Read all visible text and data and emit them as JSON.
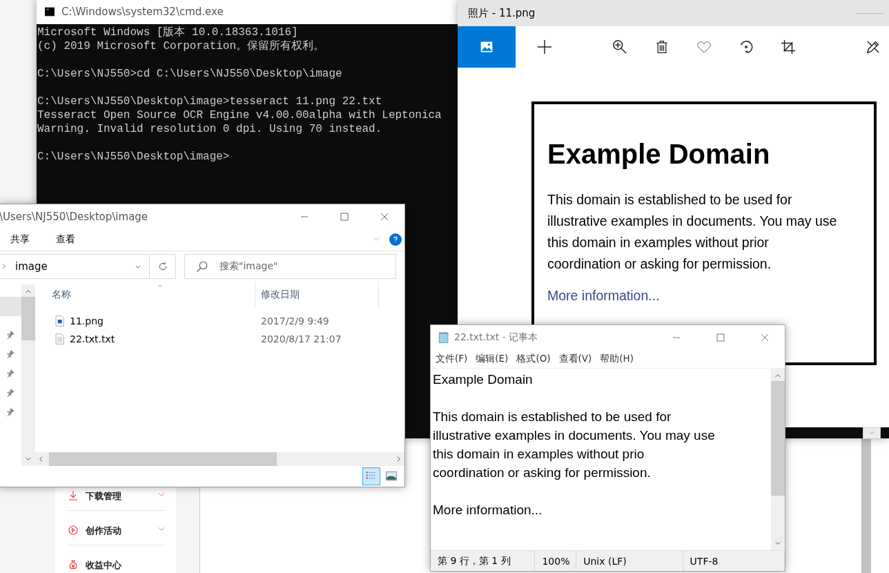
{
  "background_page": {
    "sidebar_items": [
      {
        "label": "下载管理",
        "kind": "download"
      },
      {
        "label": "创作活动",
        "kind": "activity"
      },
      {
        "label": "收益中心",
        "kind": "income"
      }
    ]
  },
  "cmd_window": {
    "title": "C:\\Windows\\system32\\cmd.exe",
    "blocks": [
      [
        "Microsoft Windows [版本 10.0.18363.1016]",
        "(c) 2019 Microsoft Corporation。保留所有权利。"
      ],
      [
        "C:\\Users\\NJ550>cd C:\\Users\\NJ550\\Desktop\\image"
      ],
      [
        "C:\\Users\\NJ550\\Desktop\\image>tesseract 11.png 22.txt",
        "Tesseract Open Source OCR Engine v4.00.00alpha with Leptonica",
        "Warning. Invalid resolution 0 dpi. Using 70 instead."
      ],
      [
        "C:\\Users\\NJ550\\Desktop\\image>"
      ]
    ]
  },
  "photos_window": {
    "title": "照片 - 11.png",
    "toolbar": [
      {
        "kind": "image",
        "selected": true,
        "disabled": false
      },
      {
        "kind": "add",
        "selected": false,
        "disabled": false
      },
      {
        "kind": "zoom-in",
        "selected": false,
        "disabled": false
      },
      {
        "kind": "delete",
        "selected": false,
        "disabled": false
      },
      {
        "kind": "favorite",
        "selected": false,
        "disabled": true
      },
      {
        "kind": "rotate",
        "selected": false,
        "disabled": false
      },
      {
        "kind": "crop",
        "selected": false,
        "disabled": false
      },
      {
        "kind": "edit",
        "selected": false,
        "disabled": false
      }
    ],
    "document": {
      "heading": "Example Domain",
      "paragraph_lines": [
        "This domain is established to be used for",
        "illustrative examples in documents. You may use",
        "this domain in examples without prior",
        "coordination or asking for permission."
      ],
      "link": "More information..."
    }
  },
  "explorer_window": {
    "title": "\\Users\\NJ550\\Desktop\\image",
    "ribbon_tabs": [
      "共享",
      "查看"
    ],
    "address": "image",
    "search": {
      "placeholder": "搜索\"image\""
    },
    "columns": [
      "名称",
      "修改日期"
    ],
    "rows": [
      {
        "name": "11.png",
        "modified": "2017/2/9 9:49",
        "kind": "image"
      },
      {
        "name": "22.txt.txt",
        "modified": "2020/8/17 21:07",
        "kind": "text"
      }
    ],
    "view_buttons": [
      {
        "kind": "details",
        "selected": true
      },
      {
        "kind": "thumbnails",
        "selected": false
      }
    ]
  },
  "notepad_window": {
    "title": "22.txt.txt - 记事本",
    "menus": [
      "文件(F)",
      "编辑(E)",
      "格式(O)",
      "查看(V)",
      "帮助(H)"
    ],
    "blocks": [
      [
        "Example Domain"
      ],
      [
        "This domain is established to be used for",
        "illustrative examples in documents. You may use",
        "this domain in examples without prio",
        "coordination or asking for permission."
      ],
      [
        "More information..."
      ]
    ],
    "status": [
      "第 9 行，第 1 列",
      "100%",
      "Unix (LF)",
      "UTF-8"
    ]
  }
}
